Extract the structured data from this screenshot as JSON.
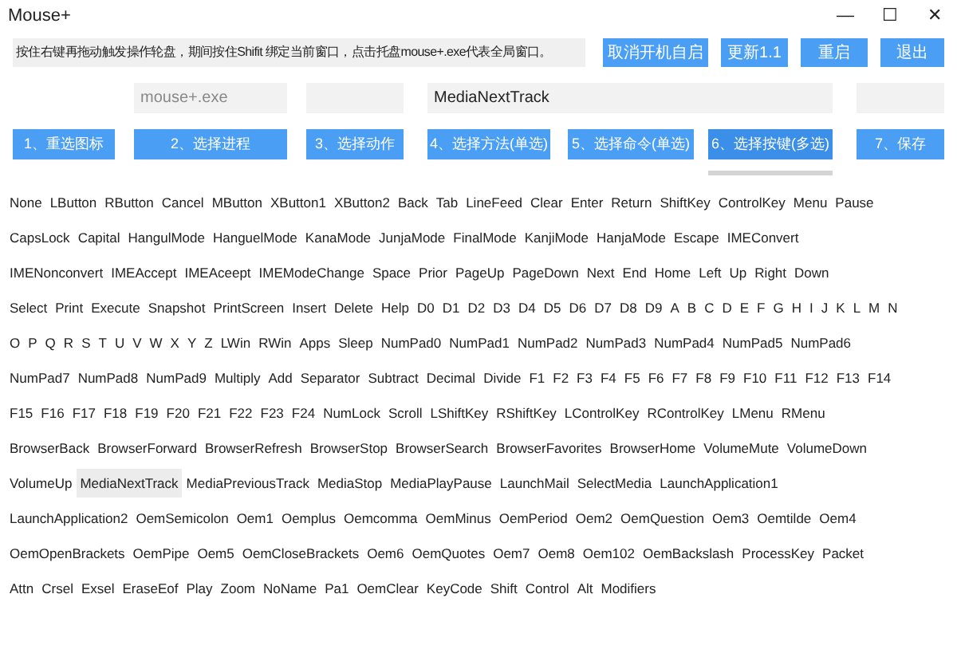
{
  "window": {
    "title": "Mouse+",
    "controls": [
      "—",
      "☐",
      "✕"
    ]
  },
  "info": "按住右键再拖动触发操作轮盘，期间按住Shifit 绑定当前窗口，点击托盘mouse+.exe代表全局窗口。",
  "top_buttons": [
    "取消开机自启",
    "更新1.1",
    "重启",
    "退出"
  ],
  "fields": [
    {
      "value": "mouse+.exe"
    },
    {
      "value": "MediaNextTrack"
    }
  ],
  "step_buttons": [
    {
      "label": "1、重选图标",
      "selected": false
    },
    {
      "label": "2、选择进程",
      "selected": false
    },
    {
      "label": "3、选择动作",
      "selected": false
    },
    {
      "label": "4、选择方法(单选)",
      "selected": false
    },
    {
      "label": "5、选择命令(单选)",
      "selected": false
    },
    {
      "label": "6、选择按键(多选)",
      "selected": true
    },
    {
      "label": "7、保存",
      "selected": false
    }
  ],
  "key_rows": [
    [
      {
        "label": "None",
        "selected": false
      },
      {
        "label": "LButton",
        "selected": false
      },
      {
        "label": "RButton",
        "selected": false
      },
      {
        "label": "Cancel",
        "selected": false
      },
      {
        "label": "MButton",
        "selected": false
      },
      {
        "label": "XButton1",
        "selected": false
      },
      {
        "label": "XButton2",
        "selected": false
      },
      {
        "label": "Back",
        "selected": false
      },
      {
        "label": "Tab",
        "selected": false
      },
      {
        "label": "LineFeed",
        "selected": false
      },
      {
        "label": "Clear",
        "selected": false
      },
      {
        "label": "Enter",
        "selected": false
      },
      {
        "label": "Return",
        "selected": false
      },
      {
        "label": "ShiftKey",
        "selected": false
      },
      {
        "label": "ControlKey",
        "selected": false
      },
      {
        "label": "Menu",
        "selected": false
      },
      {
        "label": "Pause",
        "selected": false
      }
    ],
    [
      {
        "label": "CapsLock",
        "selected": false
      },
      {
        "label": "Capital",
        "selected": false
      },
      {
        "label": "HangulMode",
        "selected": false
      },
      {
        "label": "HanguelMode",
        "selected": false
      },
      {
        "label": "KanaMode",
        "selected": false
      },
      {
        "label": "JunjaMode",
        "selected": false
      },
      {
        "label": "FinalMode",
        "selected": false
      },
      {
        "label": "KanjiMode",
        "selected": false
      },
      {
        "label": "HanjaMode",
        "selected": false
      },
      {
        "label": "Escape",
        "selected": false
      },
      {
        "label": "IMEConvert",
        "selected": false
      }
    ],
    [
      {
        "label": "IMENonconvert",
        "selected": false
      },
      {
        "label": "IMEAccept",
        "selected": false
      },
      {
        "label": "IMEAceept",
        "selected": false
      },
      {
        "label": "IMEModeChange",
        "selected": false
      },
      {
        "label": "Space",
        "selected": false
      },
      {
        "label": "Prior",
        "selected": false
      },
      {
        "label": "PageUp",
        "selected": false
      },
      {
        "label": "PageDown",
        "selected": false
      },
      {
        "label": "Next",
        "selected": false
      },
      {
        "label": "End",
        "selected": false
      },
      {
        "label": "Home",
        "selected": false
      },
      {
        "label": "Left",
        "selected": false
      },
      {
        "label": "Up",
        "selected": false
      },
      {
        "label": "Right",
        "selected": false
      },
      {
        "label": "Down",
        "selected": false
      }
    ],
    [
      {
        "label": "Select",
        "selected": false
      },
      {
        "label": "Print",
        "selected": false
      },
      {
        "label": "Execute",
        "selected": false
      },
      {
        "label": "Snapshot",
        "selected": false
      },
      {
        "label": "PrintScreen",
        "selected": false
      },
      {
        "label": "Insert",
        "selected": false
      },
      {
        "label": "Delete",
        "selected": false
      },
      {
        "label": "Help",
        "selected": false
      },
      {
        "label": "D0",
        "selected": false
      },
      {
        "label": "D1",
        "selected": false
      },
      {
        "label": "D2",
        "selected": false
      },
      {
        "label": "D3",
        "selected": false
      },
      {
        "label": "D4",
        "selected": false
      },
      {
        "label": "D5",
        "selected": false
      },
      {
        "label": "D6",
        "selected": false
      },
      {
        "label": "D7",
        "selected": false
      },
      {
        "label": "D8",
        "selected": false
      },
      {
        "label": "D9",
        "selected": false
      },
      {
        "label": "A",
        "selected": false
      },
      {
        "label": "B",
        "selected": false
      },
      {
        "label": "C",
        "selected": false
      },
      {
        "label": "D",
        "selected": false
      },
      {
        "label": "E",
        "selected": false
      },
      {
        "label": "F",
        "selected": false
      },
      {
        "label": "G",
        "selected": false
      },
      {
        "label": "H",
        "selected": false
      },
      {
        "label": "I",
        "selected": false
      },
      {
        "label": "J",
        "selected": false
      },
      {
        "label": "K",
        "selected": false
      },
      {
        "label": "L",
        "selected": false
      },
      {
        "label": "M",
        "selected": false
      },
      {
        "label": "N",
        "selected": false
      }
    ],
    [
      {
        "label": "O",
        "selected": false
      },
      {
        "label": "P",
        "selected": false
      },
      {
        "label": "Q",
        "selected": false
      },
      {
        "label": "R",
        "selected": false
      },
      {
        "label": "S",
        "selected": false
      },
      {
        "label": "T",
        "selected": false
      },
      {
        "label": "U",
        "selected": false
      },
      {
        "label": "V",
        "selected": false
      },
      {
        "label": "W",
        "selected": false
      },
      {
        "label": "X",
        "selected": false
      },
      {
        "label": "Y",
        "selected": false
      },
      {
        "label": "Z",
        "selected": false
      },
      {
        "label": "LWin",
        "selected": false
      },
      {
        "label": "RWin",
        "selected": false
      },
      {
        "label": "Apps",
        "selected": false
      },
      {
        "label": "Sleep",
        "selected": false
      },
      {
        "label": "NumPad0",
        "selected": false
      },
      {
        "label": "NumPad1",
        "selected": false
      },
      {
        "label": "NumPad2",
        "selected": false
      },
      {
        "label": "NumPad3",
        "selected": false
      },
      {
        "label": "NumPad4",
        "selected": false
      },
      {
        "label": "NumPad5",
        "selected": false
      },
      {
        "label": "NumPad6",
        "selected": false
      }
    ],
    [
      {
        "label": "NumPad7",
        "selected": false
      },
      {
        "label": "NumPad8",
        "selected": false
      },
      {
        "label": "NumPad9",
        "selected": false
      },
      {
        "label": "Multiply",
        "selected": false
      },
      {
        "label": "Add",
        "selected": false
      },
      {
        "label": "Separator",
        "selected": false
      },
      {
        "label": "Subtract",
        "selected": false
      },
      {
        "label": "Decimal",
        "selected": false
      },
      {
        "label": "Divide",
        "selected": false
      },
      {
        "label": "F1",
        "selected": false
      },
      {
        "label": "F2",
        "selected": false
      },
      {
        "label": "F3",
        "selected": false
      },
      {
        "label": "F4",
        "selected": false
      },
      {
        "label": "F5",
        "selected": false
      },
      {
        "label": "F6",
        "selected": false
      },
      {
        "label": "F7",
        "selected": false
      },
      {
        "label": "F8",
        "selected": false
      },
      {
        "label": "F9",
        "selected": false
      },
      {
        "label": "F10",
        "selected": false
      },
      {
        "label": "F11",
        "selected": false
      },
      {
        "label": "F12",
        "selected": false
      },
      {
        "label": "F13",
        "selected": false
      },
      {
        "label": "F14",
        "selected": false
      }
    ],
    [
      {
        "label": "F15",
        "selected": false
      },
      {
        "label": "F16",
        "selected": false
      },
      {
        "label": "F17",
        "selected": false
      },
      {
        "label": "F18",
        "selected": false
      },
      {
        "label": "F19",
        "selected": false
      },
      {
        "label": "F20",
        "selected": false
      },
      {
        "label": "F21",
        "selected": false
      },
      {
        "label": "F22",
        "selected": false
      },
      {
        "label": "F23",
        "selected": false
      },
      {
        "label": "F24",
        "selected": false
      },
      {
        "label": "NumLock",
        "selected": false
      },
      {
        "label": "Scroll",
        "selected": false
      },
      {
        "label": "LShiftKey",
        "selected": false
      },
      {
        "label": "RShiftKey",
        "selected": false
      },
      {
        "label": "LControlKey",
        "selected": false
      },
      {
        "label": "RControlKey",
        "selected": false
      },
      {
        "label": "LMenu",
        "selected": false
      },
      {
        "label": "RMenu",
        "selected": false
      }
    ],
    [
      {
        "label": "BrowserBack",
        "selected": false
      },
      {
        "label": "BrowserForward",
        "selected": false
      },
      {
        "label": "BrowserRefresh",
        "selected": false
      },
      {
        "label": "BrowserStop",
        "selected": false
      },
      {
        "label": "BrowserSearch",
        "selected": false
      },
      {
        "label": "BrowserFavorites",
        "selected": false
      },
      {
        "label": "BrowserHome",
        "selected": false
      },
      {
        "label": "VolumeMute",
        "selected": false
      },
      {
        "label": "VolumeDown",
        "selected": false
      }
    ],
    [
      {
        "label": "VolumeUp",
        "selected": false
      },
      {
        "label": "MediaNextTrack",
        "selected": true
      },
      {
        "label": "MediaPreviousTrack",
        "selected": false
      },
      {
        "label": "MediaStop",
        "selected": false
      },
      {
        "label": "MediaPlayPause",
        "selected": false
      },
      {
        "label": "LaunchMail",
        "selected": false
      },
      {
        "label": "SelectMedia",
        "selected": false
      },
      {
        "label": "LaunchApplication1",
        "selected": false
      }
    ],
    [
      {
        "label": "LaunchApplication2",
        "selected": false
      },
      {
        "label": "OemSemicolon",
        "selected": false
      },
      {
        "label": "Oem1",
        "selected": false
      },
      {
        "label": "Oemplus",
        "selected": false
      },
      {
        "label": "Oemcomma",
        "selected": false
      },
      {
        "label": "OemMinus",
        "selected": false
      },
      {
        "label": "OemPeriod",
        "selected": false
      },
      {
        "label": "Oem2",
        "selected": false
      },
      {
        "label": "OemQuestion",
        "selected": false
      },
      {
        "label": "Oem3",
        "selected": false
      },
      {
        "label": "Oemtilde",
        "selected": false
      },
      {
        "label": "Oem4",
        "selected": false
      }
    ],
    [
      {
        "label": "OemOpenBrackets",
        "selected": false
      },
      {
        "label": "OemPipe",
        "selected": false
      },
      {
        "label": "Oem5",
        "selected": false
      },
      {
        "label": "OemCloseBrackets",
        "selected": false
      },
      {
        "label": "Oem6",
        "selected": false
      },
      {
        "label": "OemQuotes",
        "selected": false
      },
      {
        "label": "Oem7",
        "selected": false
      },
      {
        "label": "Oem8",
        "selected": false
      },
      {
        "label": "Oem102",
        "selected": false
      },
      {
        "label": "OemBackslash",
        "selected": false
      },
      {
        "label": "ProcessKey",
        "selected": false
      },
      {
        "label": "Packet",
        "selected": false
      }
    ],
    [
      {
        "label": "Attn",
        "selected": false
      },
      {
        "label": "Crsel",
        "selected": false
      },
      {
        "label": "Exsel",
        "selected": false
      },
      {
        "label": "EraseEof",
        "selected": false
      },
      {
        "label": "Play",
        "selected": false
      },
      {
        "label": "Zoom",
        "selected": false
      },
      {
        "label": "NoName",
        "selected": false
      },
      {
        "label": "Pa1",
        "selected": false
      },
      {
        "label": "OemClear",
        "selected": false
      },
      {
        "label": "KeyCode",
        "selected": false
      },
      {
        "label": "Shift",
        "selected": false
      },
      {
        "label": "Control",
        "selected": false
      },
      {
        "label": "Alt",
        "selected": false
      },
      {
        "label": "Modifiers",
        "selected": false
      }
    ]
  ]
}
